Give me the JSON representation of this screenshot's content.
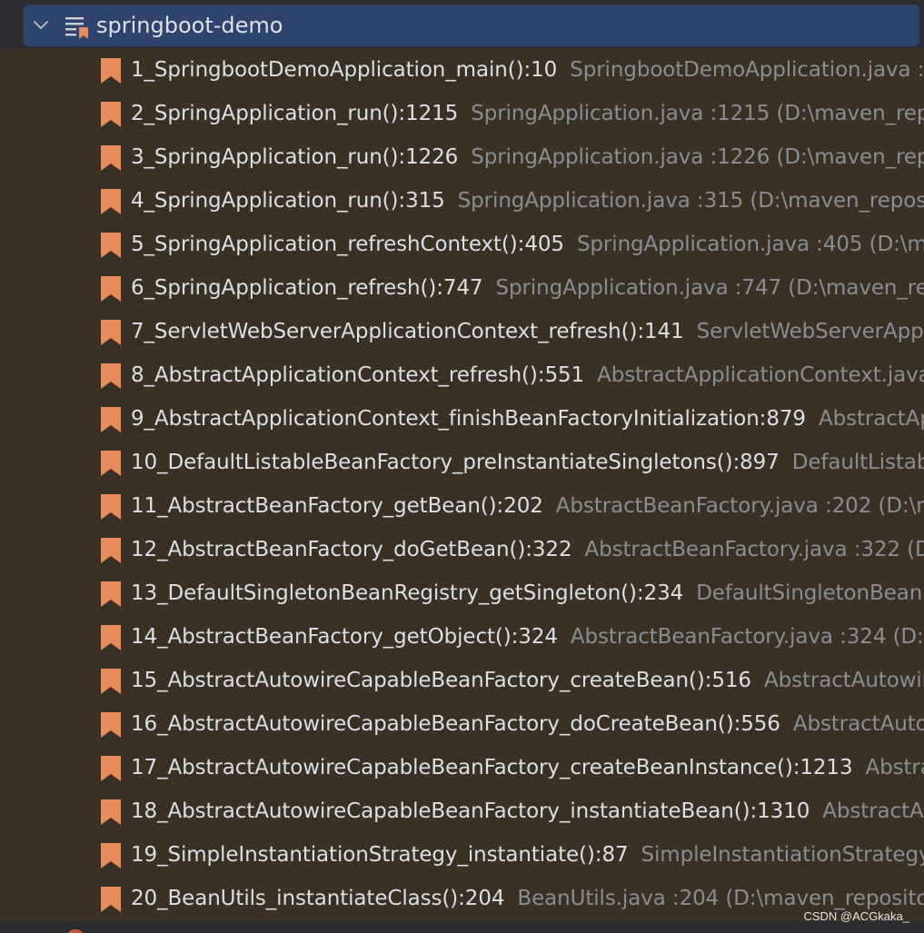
{
  "header": {
    "title": "springboot-demo"
  },
  "colors": {
    "header_bg": "#2e436e",
    "list_bg": "#3a3124",
    "bookmark": "#e58c5a",
    "name_text": "#dcdfe4",
    "location_text": "#8a8d92"
  },
  "rows": [
    {
      "name": "1_SpringbootDemoApplication_main():10",
      "location": "SpringbootDemoApplication.java :"
    },
    {
      "name": "2_SpringApplication_run():1215",
      "location": "SpringApplication.java :1215  (D:\\maven_rep"
    },
    {
      "name": "3_SpringApplication_run():1226",
      "location": "SpringApplication.java :1226  (D:\\maven_rep"
    },
    {
      "name": "4_SpringApplication_run():315",
      "location": "SpringApplication.java :315  (D:\\maven_repos"
    },
    {
      "name": "5_SpringApplication_refreshContext():405",
      "location": "SpringApplication.java :405  (D:\\m"
    },
    {
      "name": "6_SpringApplication_refresh():747",
      "location": "SpringApplication.java :747  (D:\\maven_re"
    },
    {
      "name": "7_ServletWebServerApplicationContext_refresh():141",
      "location": "ServletWebServerAppl"
    },
    {
      "name": "8_AbstractApplicationContext_refresh():551",
      "location": "AbstractApplicationContext.java"
    },
    {
      "name": "9_AbstractApplicationContext_finishBeanFactoryInitialization:879",
      "location": "AbstractAp"
    },
    {
      "name": "10_DefaultListableBeanFactory_preInstantiateSingletons():897",
      "location": "DefaultListabl"
    },
    {
      "name": "11_AbstractBeanFactory_getBean():202",
      "location": "AbstractBeanFactory.java :202  (D:\\m"
    },
    {
      "name": "12_AbstractBeanFactory_doGetBean():322",
      "location": "AbstractBeanFactory.java :322  (D"
    },
    {
      "name": "13_DefaultSingletonBeanRegistry_getSingleton():234",
      "location": "DefaultSingletonBeanF"
    },
    {
      "name": "14_AbstractBeanFactory_getObject():324",
      "location": "AbstractBeanFactory.java :324  (D:\\"
    },
    {
      "name": "15_AbstractAutowireCapableBeanFactory_createBean():516",
      "location": "AbstractAutowir"
    },
    {
      "name": "16_AbstractAutowireCapableBeanFactory_doCreateBean():556",
      "location": "AbstractAuto"
    },
    {
      "name": "17_AbstractAutowireCapableBeanFactory_createBeanInstance():1213",
      "location": "Abstra"
    },
    {
      "name": "18_AbstractAutowireCapableBeanFactory_instantiateBean():1310",
      "location": "AbstractAu"
    },
    {
      "name": "19_SimpleInstantiationStrategy_instantiate():87",
      "location": "SimpleInstantiationStrategy."
    },
    {
      "name": "20_BeanUtils_instantiateClass():204",
      "location": "BeanUtils.java :204  (D:\\maven_repositor"
    }
  ],
  "watermark": "CSDN @ACGkaka_"
}
